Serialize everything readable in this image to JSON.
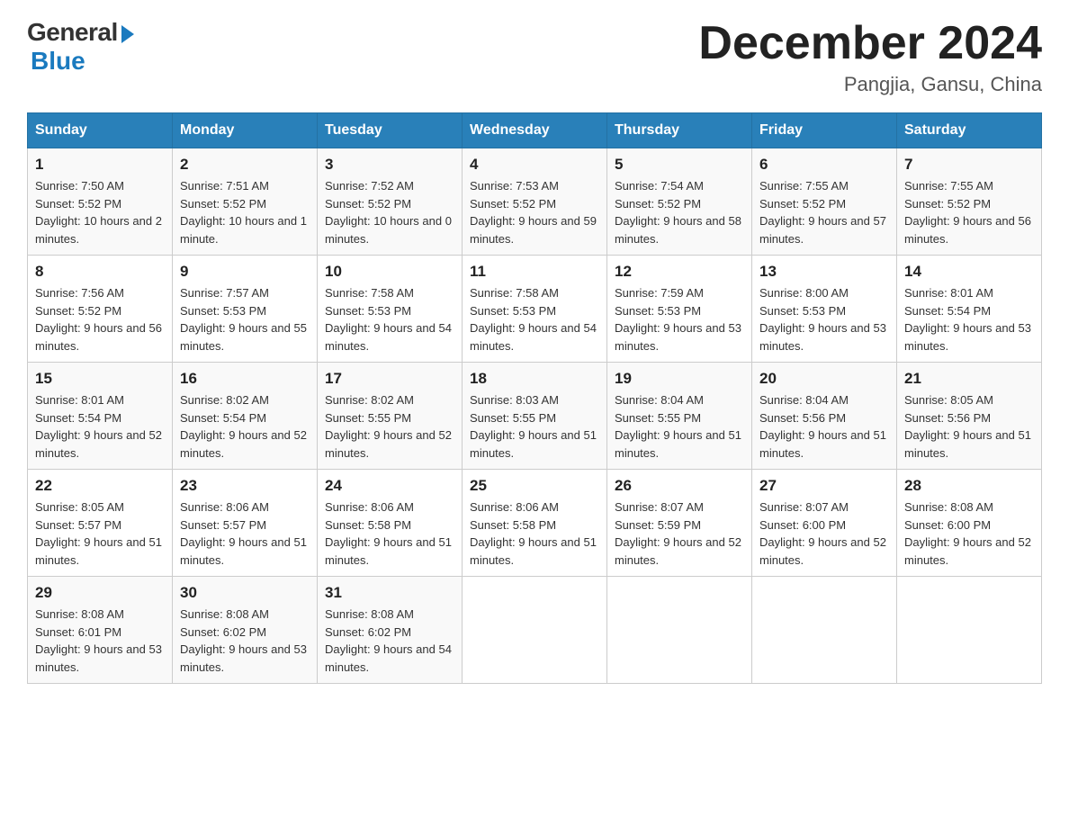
{
  "header": {
    "logo_general": "General",
    "logo_blue": "Blue",
    "title": "December 2024",
    "subtitle": "Pangjia, Gansu, China"
  },
  "days_of_week": [
    "Sunday",
    "Monday",
    "Tuesday",
    "Wednesday",
    "Thursday",
    "Friday",
    "Saturday"
  ],
  "weeks": [
    [
      {
        "day": "1",
        "sunrise": "7:50 AM",
        "sunset": "5:52 PM",
        "daylight": "10 hours and 2 minutes."
      },
      {
        "day": "2",
        "sunrise": "7:51 AM",
        "sunset": "5:52 PM",
        "daylight": "10 hours and 1 minute."
      },
      {
        "day": "3",
        "sunrise": "7:52 AM",
        "sunset": "5:52 PM",
        "daylight": "10 hours and 0 minutes."
      },
      {
        "day": "4",
        "sunrise": "7:53 AM",
        "sunset": "5:52 PM",
        "daylight": "9 hours and 59 minutes."
      },
      {
        "day": "5",
        "sunrise": "7:54 AM",
        "sunset": "5:52 PM",
        "daylight": "9 hours and 58 minutes."
      },
      {
        "day": "6",
        "sunrise": "7:55 AM",
        "sunset": "5:52 PM",
        "daylight": "9 hours and 57 minutes."
      },
      {
        "day": "7",
        "sunrise": "7:55 AM",
        "sunset": "5:52 PM",
        "daylight": "9 hours and 56 minutes."
      }
    ],
    [
      {
        "day": "8",
        "sunrise": "7:56 AM",
        "sunset": "5:52 PM",
        "daylight": "9 hours and 56 minutes."
      },
      {
        "day": "9",
        "sunrise": "7:57 AM",
        "sunset": "5:53 PM",
        "daylight": "9 hours and 55 minutes."
      },
      {
        "day": "10",
        "sunrise": "7:58 AM",
        "sunset": "5:53 PM",
        "daylight": "9 hours and 54 minutes."
      },
      {
        "day": "11",
        "sunrise": "7:58 AM",
        "sunset": "5:53 PM",
        "daylight": "9 hours and 54 minutes."
      },
      {
        "day": "12",
        "sunrise": "7:59 AM",
        "sunset": "5:53 PM",
        "daylight": "9 hours and 53 minutes."
      },
      {
        "day": "13",
        "sunrise": "8:00 AM",
        "sunset": "5:53 PM",
        "daylight": "9 hours and 53 minutes."
      },
      {
        "day": "14",
        "sunrise": "8:01 AM",
        "sunset": "5:54 PM",
        "daylight": "9 hours and 53 minutes."
      }
    ],
    [
      {
        "day": "15",
        "sunrise": "8:01 AM",
        "sunset": "5:54 PM",
        "daylight": "9 hours and 52 minutes."
      },
      {
        "day": "16",
        "sunrise": "8:02 AM",
        "sunset": "5:54 PM",
        "daylight": "9 hours and 52 minutes."
      },
      {
        "day": "17",
        "sunrise": "8:02 AM",
        "sunset": "5:55 PM",
        "daylight": "9 hours and 52 minutes."
      },
      {
        "day": "18",
        "sunrise": "8:03 AM",
        "sunset": "5:55 PM",
        "daylight": "9 hours and 51 minutes."
      },
      {
        "day": "19",
        "sunrise": "8:04 AM",
        "sunset": "5:55 PM",
        "daylight": "9 hours and 51 minutes."
      },
      {
        "day": "20",
        "sunrise": "8:04 AM",
        "sunset": "5:56 PM",
        "daylight": "9 hours and 51 minutes."
      },
      {
        "day": "21",
        "sunrise": "8:05 AM",
        "sunset": "5:56 PM",
        "daylight": "9 hours and 51 minutes."
      }
    ],
    [
      {
        "day": "22",
        "sunrise": "8:05 AM",
        "sunset": "5:57 PM",
        "daylight": "9 hours and 51 minutes."
      },
      {
        "day": "23",
        "sunrise": "8:06 AM",
        "sunset": "5:57 PM",
        "daylight": "9 hours and 51 minutes."
      },
      {
        "day": "24",
        "sunrise": "8:06 AM",
        "sunset": "5:58 PM",
        "daylight": "9 hours and 51 minutes."
      },
      {
        "day": "25",
        "sunrise": "8:06 AM",
        "sunset": "5:58 PM",
        "daylight": "9 hours and 51 minutes."
      },
      {
        "day": "26",
        "sunrise": "8:07 AM",
        "sunset": "5:59 PM",
        "daylight": "9 hours and 52 minutes."
      },
      {
        "day": "27",
        "sunrise": "8:07 AM",
        "sunset": "6:00 PM",
        "daylight": "9 hours and 52 minutes."
      },
      {
        "day": "28",
        "sunrise": "8:08 AM",
        "sunset": "6:00 PM",
        "daylight": "9 hours and 52 minutes."
      }
    ],
    [
      {
        "day": "29",
        "sunrise": "8:08 AM",
        "sunset": "6:01 PM",
        "daylight": "9 hours and 53 minutes."
      },
      {
        "day": "30",
        "sunrise": "8:08 AM",
        "sunset": "6:02 PM",
        "daylight": "9 hours and 53 minutes."
      },
      {
        "day": "31",
        "sunrise": "8:08 AM",
        "sunset": "6:02 PM",
        "daylight": "9 hours and 54 minutes."
      },
      null,
      null,
      null,
      null
    ]
  ]
}
